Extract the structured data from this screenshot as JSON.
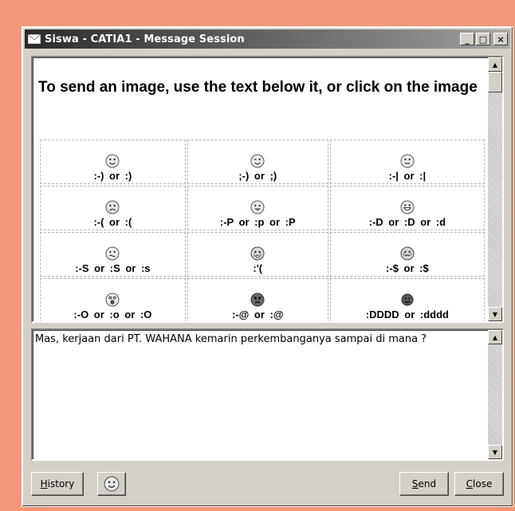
{
  "window": {
    "title": "Siswa - CATIA1 - Message Session",
    "title_icon": "envelope-icon",
    "controls": {
      "minimize": "_",
      "maximize": "□",
      "close": "×"
    }
  },
  "emoticon_panel": {
    "heading": "To send an image, use the text below it, or click on the image",
    "rows": [
      [
        {
          "icon": "smile",
          "code": ":-) or :)"
        },
        {
          "icon": "wink",
          "code": ";-) or ;)"
        },
        {
          "icon": "neutral",
          "code": ":-| or :|"
        }
      ],
      [
        {
          "icon": "sad",
          "code": ":-( or :("
        },
        {
          "icon": "tongue",
          "code": ":-P or :p or :P"
        },
        {
          "icon": "grin",
          "code": ":-D or :D or :d"
        }
      ],
      [
        {
          "icon": "confused",
          "code": ":-S or :S or :s"
        },
        {
          "icon": "crying",
          "code": ":'("
        },
        {
          "icon": "embarrassed",
          "code": ":-$ or :$"
        }
      ],
      [
        {
          "icon": "surprised",
          "code": ":-O or :o or :O"
        },
        {
          "icon": "angry",
          "code": ":-@ or :@"
        },
        {
          "icon": "dark-smile",
          "code": ":DDDD or :dddd"
        }
      ]
    ]
  },
  "message_input": {
    "value": "Mas, kerjaan dari PT. WAHANA kemarin perkembanganya sampai di mana ?"
  },
  "buttons": {
    "history": "History",
    "emoticon": "smiley-icon",
    "send": "Send",
    "close": "Close"
  }
}
